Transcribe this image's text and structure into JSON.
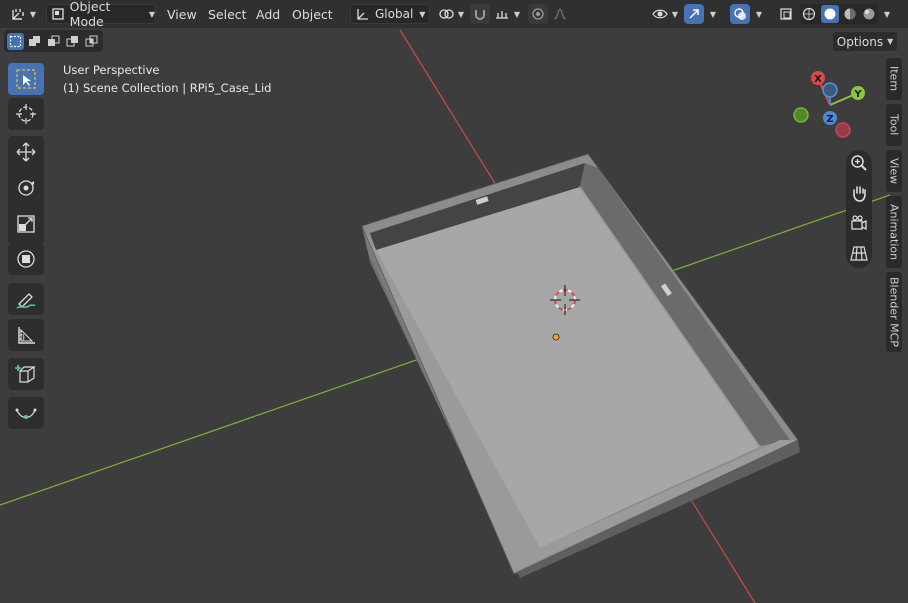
{
  "header": {
    "mode_label": "Object Mode",
    "menus": [
      "View",
      "Select",
      "Add",
      "Object"
    ],
    "transform_orientation": "Global"
  },
  "options_label": "Options",
  "viewport": {
    "perspective_label": "User Perspective",
    "collection_label": "(1) Scene Collection | RPi5_Case_Lid"
  },
  "gizmo": {
    "x_label": "X",
    "y_label": "Y",
    "z_label": "Z"
  },
  "side_tabs": [
    "Item",
    "Tool",
    "View",
    "Animation",
    "Blender MCP"
  ],
  "tools": [
    {
      "name": "select-box-tool",
      "icon": "select-box-icon"
    },
    {
      "name": "cursor-tool",
      "icon": "cursor-icon"
    },
    {
      "name": "move-tool",
      "icon": "move-icon"
    },
    {
      "name": "rotate-tool",
      "icon": "rotate-icon"
    },
    {
      "name": "scale-tool",
      "icon": "scale-icon"
    },
    {
      "name": "transform-tool",
      "icon": "transform-icon"
    },
    {
      "name": "annotate-tool",
      "icon": "annotate-icon"
    },
    {
      "name": "measure-tool",
      "icon": "measure-icon"
    },
    {
      "name": "add-cube-tool",
      "icon": "add-cube-icon"
    },
    {
      "name": "curve-tool",
      "icon": "curve-icon"
    }
  ],
  "colors": {
    "accent": "#4772b3",
    "x_axis": "#d94a4a",
    "y_axis": "#8cc63f",
    "z_axis": "#4a8bd9",
    "background": "#3d3d3d"
  }
}
